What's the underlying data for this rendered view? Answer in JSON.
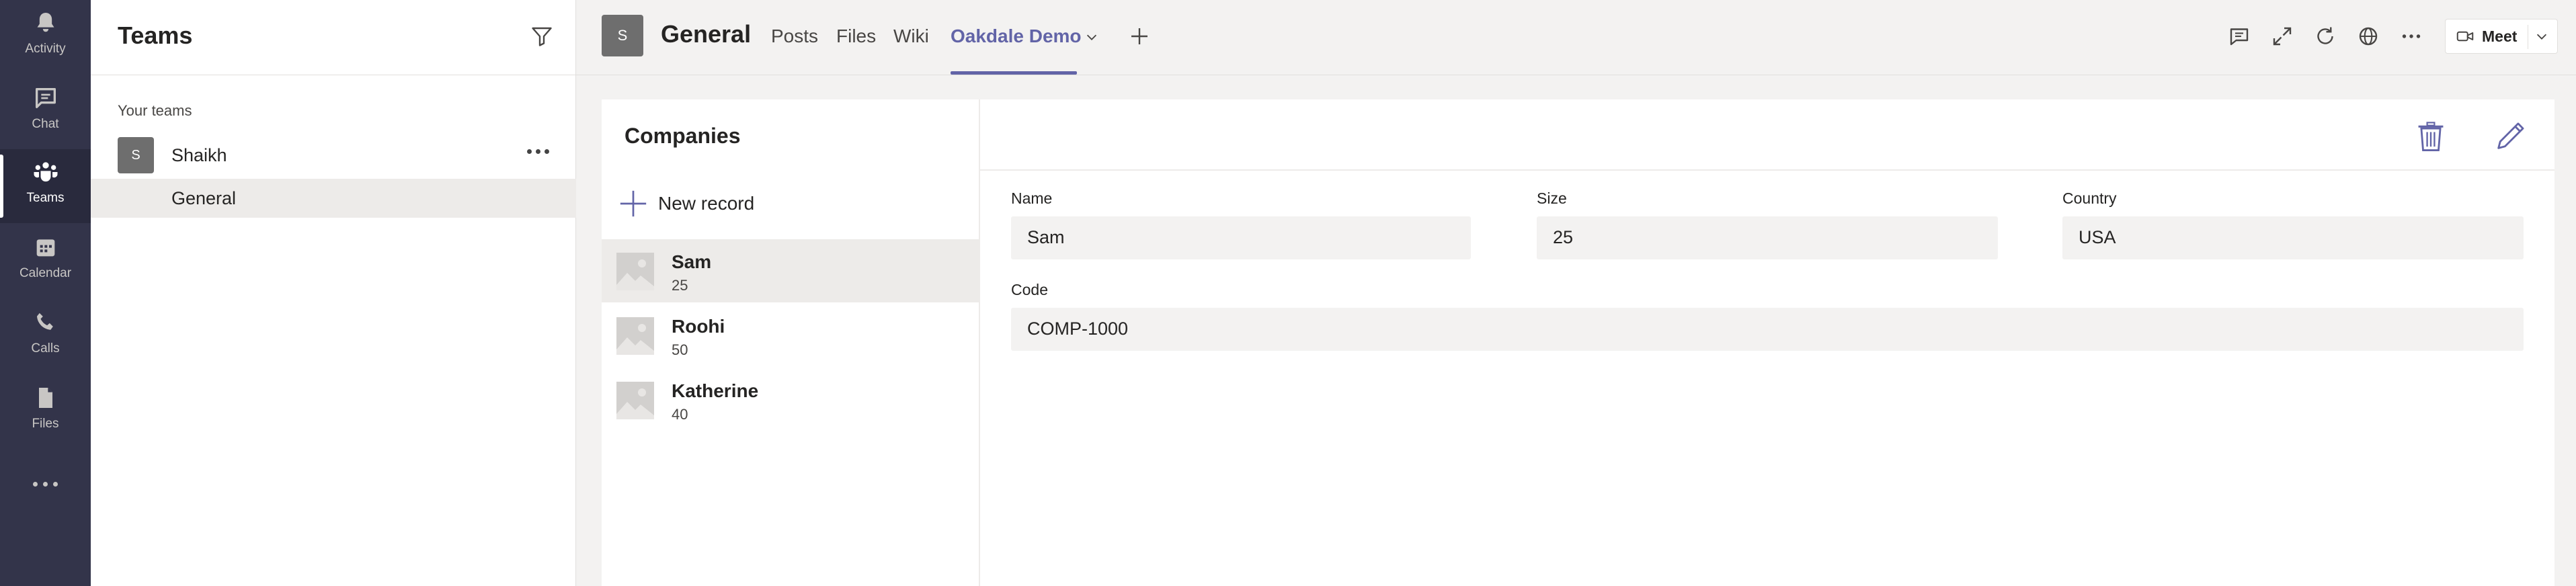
{
  "rail": {
    "items": [
      {
        "label": "Activity",
        "icon": "bell-icon"
      },
      {
        "label": "Chat",
        "icon": "chat-icon"
      },
      {
        "label": "Teams",
        "icon": "teams-icon"
      },
      {
        "label": "Calendar",
        "icon": "calendar-icon"
      },
      {
        "label": "Calls",
        "icon": "phone-icon"
      },
      {
        "label": "Files",
        "icon": "file-icon"
      }
    ]
  },
  "teams_panel": {
    "title": "Teams",
    "section_label": "Your teams",
    "team": {
      "avatar_letter": "S",
      "name": "Shaikh"
    },
    "channel": "General"
  },
  "topbar": {
    "avatar_letter": "S",
    "channel_title": "General",
    "tabs": [
      "Posts",
      "Files",
      "Wiki",
      "Oakdale Demo"
    ],
    "meet_label": "Meet",
    "accent_color": "#6264a7"
  },
  "app": {
    "list_title": "Companies",
    "new_record_label": "New record",
    "records": [
      {
        "name": "Sam",
        "size": "25"
      },
      {
        "name": "Roohi",
        "size": "50"
      },
      {
        "name": "Katherine",
        "size": "40"
      }
    ],
    "form": {
      "name_label": "Name",
      "name_value": "Sam",
      "size_label": "Size",
      "size_value": "25",
      "country_label": "Country",
      "country_value": "USA",
      "code_label": "Code",
      "code_value": "COMP-1000"
    }
  }
}
